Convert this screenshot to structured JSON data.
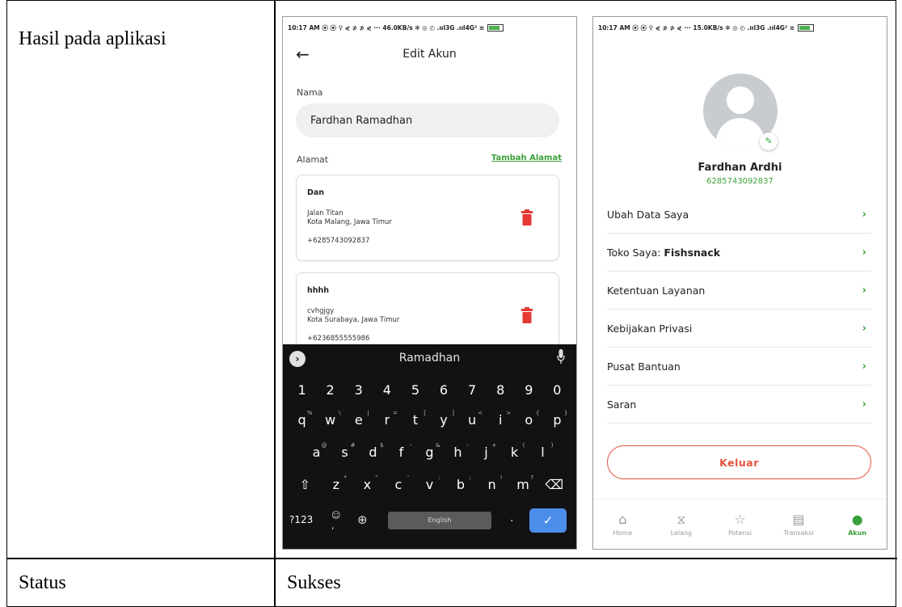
{
  "doc": {
    "row1_label": "Hasil pada aplikasi",
    "row2_label": "Status",
    "row2_value": "Sukses"
  },
  "phone_left": {
    "status_bar": "10:17 AM ⦿ ⦿ ⚲ ⋞ ⊅ ⊅ ⋞ ··· 46.0KB/s ✻ ◎ ◴ .ııl3G .ııl4G² ≋",
    "title": "Edit Akun",
    "name_label": "Nama",
    "name_value": "Fardhan Ramadhan",
    "address_label": "Alamat",
    "add_address_link": "Tambah Alamat",
    "addresses": [
      {
        "name": "Dan",
        "street": "Jalan Titan",
        "city": "Kota Malang, Jawa Timur",
        "phone": "+6285743092837"
      },
      {
        "name": "hhhh",
        "street": "cvhgjgy",
        "city": "Kota Surabaya, Jawa Timur",
        "phone": "+6236855555986"
      }
    ],
    "keyboard": {
      "suggestion": "Ramadhan",
      "language": "English",
      "mode_key": "?123",
      "row_numbers": [
        "1",
        "2",
        "3",
        "4",
        "5",
        "6",
        "7",
        "8",
        "9",
        "0"
      ],
      "row_top": [
        "q",
        "w",
        "e",
        "r",
        "t",
        "y",
        "u",
        "i",
        "o",
        "p"
      ],
      "row_top_alt": [
        "%",
        "\\",
        "|",
        "=",
        "[",
        "]",
        "<",
        ">",
        "{",
        "}"
      ],
      "row_mid": [
        "a",
        "s",
        "d",
        "f",
        "g",
        "h",
        "j",
        "k",
        "l"
      ],
      "row_mid_alt": [
        "@",
        "#",
        "$",
        "-",
        "&",
        "-",
        "+",
        "(",
        ")"
      ],
      "row_bot": [
        "z",
        "x",
        "c",
        "v",
        "b",
        "n",
        "m"
      ],
      "row_bot_alt": [
        "*",
        "\"",
        "'",
        ":",
        ";",
        "!",
        "?"
      ]
    }
  },
  "phone_right": {
    "status_bar": "10:17 AM ⦿ ⦿ ⚲ ⋞ ⊅ ⊅ ⋞ ··· 15.0KB/s ✻ ◎ ◴ .ııl3G .ııl4G² ≋",
    "profile_name": "Fardhan Ardhi",
    "profile_phone": "6285743092837",
    "menu": [
      {
        "label": "Ubah Data Saya",
        "bold_suffix": ""
      },
      {
        "label": "Toko Saya: ",
        "bold_suffix": "Fishsnack"
      },
      {
        "label": "Ketentuan Layanan",
        "bold_suffix": ""
      },
      {
        "label": "Kebijakan Privasi",
        "bold_suffix": ""
      },
      {
        "label": "Pusat Bantuan",
        "bold_suffix": ""
      },
      {
        "label": "Saran",
        "bold_suffix": ""
      }
    ],
    "logout": "Keluar",
    "nav": [
      {
        "label": "Home",
        "icon": "home-icon"
      },
      {
        "label": "Lelang",
        "icon": "hourglass-icon"
      },
      {
        "label": "Potensi",
        "icon": "star-icon"
      },
      {
        "label": "Transaksi",
        "icon": "receipt-icon"
      },
      {
        "label": "Akun",
        "icon": "person-icon"
      }
    ]
  },
  "colors": {
    "accent_green": "#3aa13a",
    "danger_red": "#e5533d",
    "trash_red": "#e53935",
    "keyboard_bg": "#121212",
    "enter_blue": "#4a8eea"
  }
}
